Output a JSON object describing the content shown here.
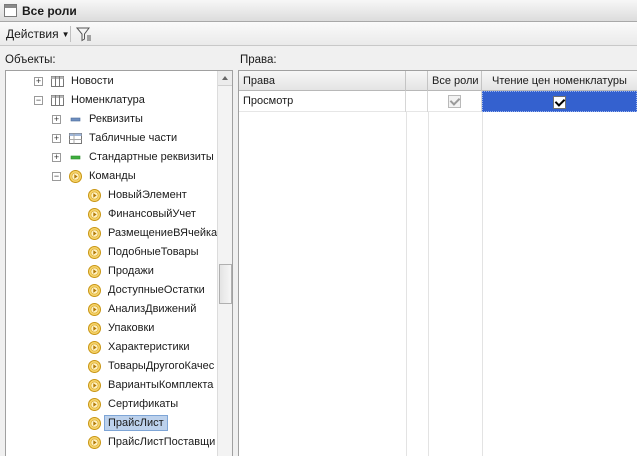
{
  "window": {
    "title": "Все роли"
  },
  "toolbar": {
    "actions_label": "Действия",
    "actions_caret": "▼"
  },
  "left": {
    "label": "Объекты:"
  },
  "right": {
    "label": "Права:"
  },
  "tree": [
    {
      "label": "Новости",
      "expander": "+",
      "icon": "table-icon"
    },
    {
      "label": "Номенклатура",
      "expander": "−",
      "icon": "table-icon"
    },
    {
      "label": "Реквизиты",
      "expander": "+",
      "icon": "attribute-icon"
    },
    {
      "label": "Табличные части",
      "expander": "+",
      "icon": "tabular-section-icon"
    },
    {
      "label": "Стандартные реквизиты",
      "expander": "+",
      "icon": "standard-attribute-icon"
    },
    {
      "label": "Команды",
      "expander": "−",
      "icon": "command-icon"
    },
    {
      "label": "НовыйЭлемент",
      "icon": "command-icon"
    },
    {
      "label": "ФинансовыйУчет",
      "icon": "command-icon"
    },
    {
      "label": "РазмещениеВЯчейка",
      "icon": "command-icon"
    },
    {
      "label": "ПодобныеТовары",
      "icon": "command-icon"
    },
    {
      "label": "Продажи",
      "icon": "command-icon"
    },
    {
      "label": "ДоступныеОстатки",
      "icon": "command-icon"
    },
    {
      "label": "АнализДвижений",
      "icon": "command-icon"
    },
    {
      "label": "Упаковки",
      "icon": "command-icon"
    },
    {
      "label": "Характеристики",
      "icon": "command-icon"
    },
    {
      "label": "ТоварыДругогоКачес",
      "icon": "command-icon"
    },
    {
      "label": "ВариантыКомплекта",
      "icon": "command-icon"
    },
    {
      "label": "Сертификаты",
      "icon": "command-icon"
    },
    {
      "label": "ПрайсЛист",
      "icon": "command-icon",
      "selected": true
    },
    {
      "label": "ПрайсЛистПоставщи",
      "icon": "command-icon"
    }
  ],
  "grid": {
    "columns": [
      "Права",
      "",
      "Все роли",
      "Чтение цен номенклатуры"
    ],
    "rows": [
      {
        "right": "Просмотр",
        "all_roles": true,
        "read_prices": true
      }
    ]
  },
  "colors": {
    "selection": "#3461cf",
    "tree_selection": "#bcd1ec",
    "command_icon": "#e6b422"
  }
}
